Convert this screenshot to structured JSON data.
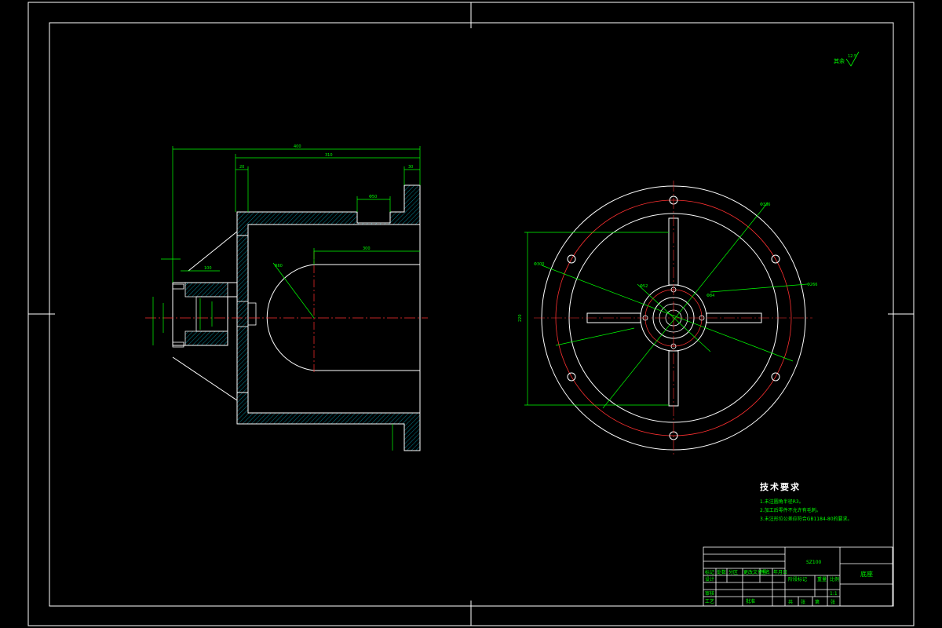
{
  "roughness_mark": "其余",
  "roughness_value": "12.5",
  "notes": {
    "title": "技术要求",
    "items": [
      "1.未注圆角半径R3。",
      "2.加工后零件不允许有毛刺。",
      "3.未注形位公差应符合GB1184-80的要求。"
    ]
  },
  "title_block": {
    "drawing_no": "SZ100",
    "part_name": "底座",
    "scale": "1:1",
    "labels": [
      "标记",
      "处数",
      "分区",
      "更改文件号",
      "签名",
      "年月日",
      "设计",
      "审核",
      "工艺",
      "批准",
      "阶段标记",
      "重量",
      "比例",
      "共",
      "张",
      "第",
      "张"
    ]
  }
}
